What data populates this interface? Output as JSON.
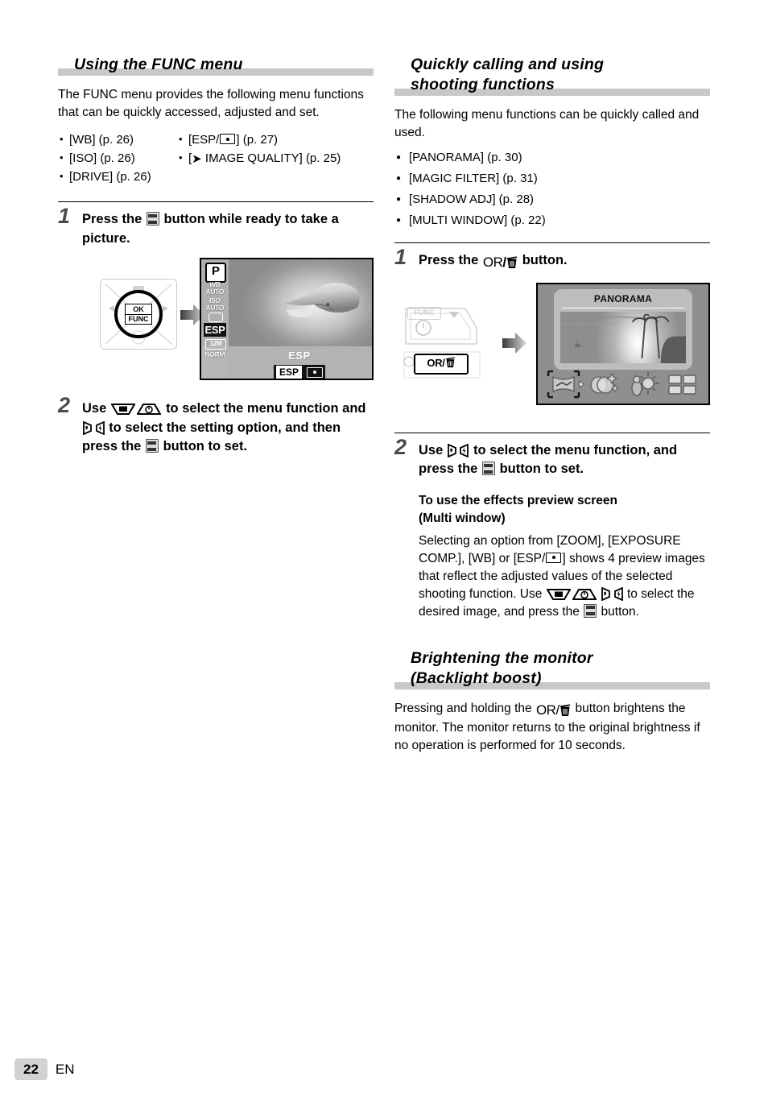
{
  "page": {
    "number": "22",
    "language": "EN"
  },
  "left_column": {
    "heading": "Using the FUNC menu",
    "intro": "The FUNC menu provides the following menu functions that can be quickly accessed, adjusted and set.",
    "menu_list_left": [
      "[WB] (p. 26)",
      "[ISO] (p. 26)",
      "[DRIVE] (p. 26)"
    ],
    "menu_list_right_1_pre": "[ESP/",
    "menu_list_right_1_post": "] (p. 27)",
    "menu_list_right_2_pre": "[",
    "menu_list_right_2_post": " IMAGE QUALITY] (p. 25)",
    "step1": {
      "number": "1",
      "text_before": "Press the",
      "text_after": "button while ready to take a picture."
    },
    "step2": {
      "number": "2",
      "t1": "Use",
      "t2": "to select the menu function and",
      "t3": "to select the setting option, and then press the",
      "t4": "button to set."
    },
    "figure": {
      "pad_label_line1": "OK",
      "pad_label_line2": "FUNC",
      "lcd": {
        "mode": "P",
        "wb_label": "WB",
        "wb_value": "AUTO",
        "iso_label": "ISO",
        "iso_value": "AUTO",
        "metering": "ESP",
        "image_size": "12M",
        "compression": "NORM",
        "bottom_title": "ESP",
        "bottom_selected": "ESP"
      }
    }
  },
  "right_column": {
    "heading_line1": "Quickly calling and using",
    "heading_line2": "shooting functions",
    "intro": "The following menu functions can be quickly called and used.",
    "function_list": [
      "[PANORAMA] (p. 30)",
      "[MAGIC FILTER] (p. 31)",
      "[SHADOW ADJ] (p. 28)",
      "[MULTI WINDOW] (p. 22)"
    ],
    "step1": {
      "number": "1",
      "text_before": "Press the",
      "text_after": "button."
    },
    "step2": {
      "number": "2",
      "t1": "Use",
      "t2": "to select the menu function, and press the",
      "t3": "button to set."
    },
    "subsection": {
      "heading_line1": "To use the effects preview screen",
      "heading_line2": "(Multi window)",
      "b1": "Selecting an option from [ZOOM], [EXPOSURE COMP.], [WB] or [ESP/",
      "b2": "] shows 4 preview images that reflect the adjusted values of the selected shooting function. Use",
      "b3": "to select the desired image, and press the",
      "b4": "button."
    },
    "brightening": {
      "heading_line1": "Brightening the monitor",
      "heading_line2": "(Backlight boost)",
      "b1": "Pressing and holding the",
      "b2": "button brightens the monitor. The monitor returns to the original brightness if no operation is performed for 10 seconds."
    },
    "figure": {
      "func_button_label": "FUNC",
      "or_delete_label": "OR/",
      "panorama_title": "PANORAMA"
    }
  },
  "colors": {
    "heading_rule": "#c8c8c8",
    "step_number": "#4a4a4a",
    "page_badge": "#d2d2d2"
  }
}
